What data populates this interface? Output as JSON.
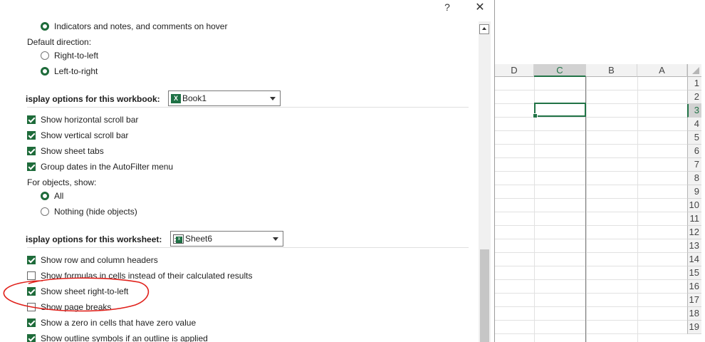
{
  "dialog": {
    "help_label": "?",
    "close_label": "✕",
    "comments_option": "Indicators and notes, and comments on hover",
    "default_direction_label": "Default direction:",
    "direction_rtl": "Right-to-left",
    "direction_ltr": "Left-to-right",
    "workbook_section": {
      "label": "isplay options for this workbook:",
      "dropdown_value": "Book1",
      "options": [
        {
          "label": "Show horizontal scroll bar",
          "checked": true
        },
        {
          "label": "Show vertical scroll bar",
          "checked": true
        },
        {
          "label": "Show sheet tabs",
          "checked": true
        },
        {
          "label": "Group dates in the AutoFilter menu",
          "checked": true
        }
      ],
      "objects_label": "For objects, show:",
      "objects_all": "All",
      "objects_nothing": "Nothing (hide objects)"
    },
    "worksheet_section": {
      "label": "isplay options for this worksheet:",
      "dropdown_value": "Sheet6",
      "options": [
        {
          "label": "Show row and column headers",
          "checked": true
        },
        {
          "label": "Show formulas in cells instead of their calculated results",
          "checked": false
        },
        {
          "label": "Show sheet right-to-left",
          "checked": true
        },
        {
          "label": "Show page breaks",
          "checked": false
        },
        {
          "label": "Show a zero in cells that have zero value",
          "checked": true
        },
        {
          "label": "Show outline symbols if an outline is applied",
          "checked": true
        }
      ]
    }
  },
  "sheet": {
    "columns": [
      "D",
      "C",
      "B",
      "A"
    ],
    "rows": [
      "1",
      "2",
      "3",
      "4",
      "5",
      "6",
      "7",
      "8",
      "9",
      "10",
      "11",
      "12",
      "13",
      "14",
      "15",
      "16",
      "17",
      "18",
      "19"
    ],
    "active_column": "C",
    "active_row": "3"
  },
  "colors": {
    "accent": "#217346",
    "annotation": "#e0201a"
  }
}
